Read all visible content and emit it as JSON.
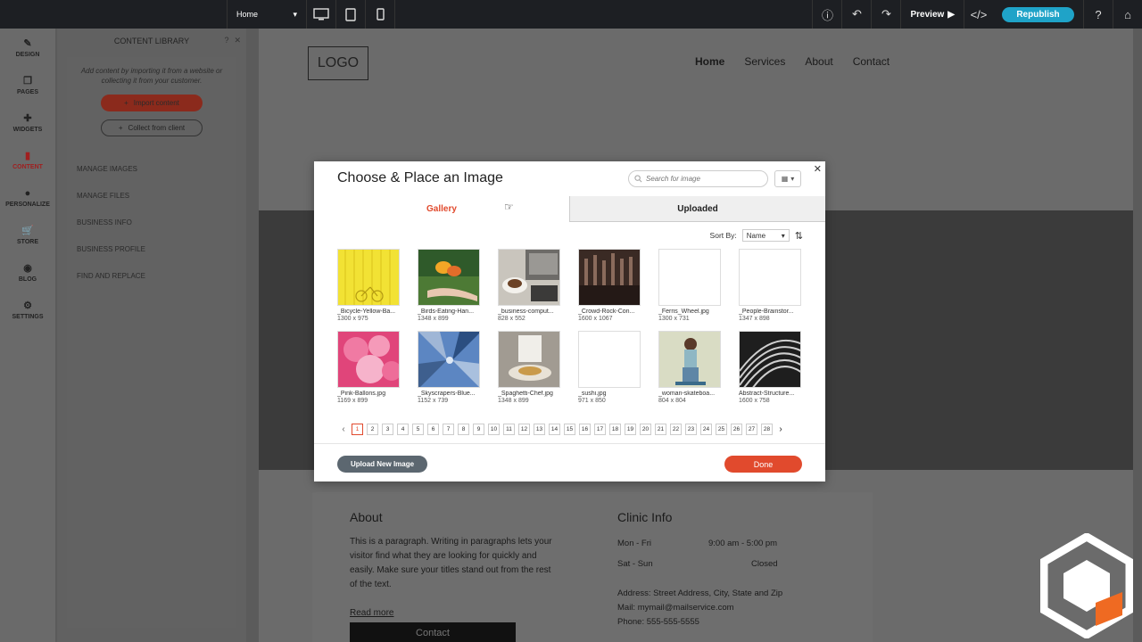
{
  "topbar": {
    "page_select": "Home",
    "preview_label": "Preview",
    "republish_label": "Republish"
  },
  "rail": {
    "items": [
      {
        "label": "DESIGN",
        "icon": "brush-icon"
      },
      {
        "label": "PAGES",
        "icon": "pages-icon"
      },
      {
        "label": "WIDGETS",
        "icon": "plus-icon"
      },
      {
        "label": "CONTENT",
        "icon": "folder-icon"
      },
      {
        "label": "PERSONALIZE",
        "icon": "person-icon"
      },
      {
        "label": "STORE",
        "icon": "cart-icon"
      },
      {
        "label": "BLOG",
        "icon": "chat-icon"
      },
      {
        "label": "SETTINGS",
        "icon": "gear-icon"
      }
    ],
    "active": "CONTENT"
  },
  "panel": {
    "title": "CONTENT LIBRARY",
    "description": "Add content by importing it from a website or collecting it from your customer.",
    "import_label": "Import content",
    "collect_label": "Collect from client",
    "links": [
      "MANAGE IMAGES",
      "MANAGE FILES",
      "BUSINESS INFO",
      "BUSINESS PROFILE",
      "FIND AND REPLACE"
    ]
  },
  "site": {
    "logo": "LOGO",
    "nav": [
      "Home",
      "Services",
      "About",
      "Contact"
    ],
    "about_title": "About",
    "about_text": "This is a paragraph. Writing in paragraphs lets your visitor find what they are looking for quickly and easily. Make sure your titles stand out from the rest of the text.",
    "read_more": "Read more",
    "contact_label": "Contact",
    "clinic_title": "Clinic Info",
    "hours": [
      {
        "day": "Mon - Fri",
        "time": "9:00 am - 5:00 pm"
      },
      {
        "day": "Sat - Sun",
        "time": "Closed"
      }
    ],
    "address": "Address: Street Address, City, State and Zip",
    "mail": "Mail: mymail@mailservice.com",
    "phone": "Phone: 555-555-5555"
  },
  "modal": {
    "title": "Choose & Place an Image",
    "search_placeholder": "Search for image",
    "tabs": [
      "Gallery",
      "Uploaded"
    ],
    "sort_label": "Sort By:",
    "sort_value": "Name",
    "images": [
      {
        "name": "_Bicycle-Yellow-Ba...",
        "dims": "1300 x 975"
      },
      {
        "name": "_Birds-Eating-Han...",
        "dims": "1348 x 899"
      },
      {
        "name": "_business-comput...",
        "dims": "828 x 552"
      },
      {
        "name": "_Crowd-Rock-Con...",
        "dims": "1600 x 1067"
      },
      {
        "name": "_Ferris_Wheel.jpg",
        "dims": "1300 x 731"
      },
      {
        "name": "_People-Brainstor...",
        "dims": "1347 x 898"
      },
      {
        "name": "_Pink-Ballons.jpg",
        "dims": "1169 x 899"
      },
      {
        "name": "_Skyscrapers-Blue...",
        "dims": "1152 x 739"
      },
      {
        "name": "_Spaghetti-Chef.jpg",
        "dims": "1348 x 899"
      },
      {
        "name": "_sushi.jpg",
        "dims": "971 x 850"
      },
      {
        "name": "_woman-skateboa...",
        "dims": "804 x 804"
      },
      {
        "name": "Abstract-Structure...",
        "dims": "1600 x 758"
      }
    ],
    "pages": [
      "1",
      "2",
      "3",
      "4",
      "5",
      "6",
      "7",
      "8",
      "9",
      "10",
      "11",
      "12",
      "13",
      "14",
      "15",
      "16",
      "17",
      "18",
      "19",
      "20",
      "21",
      "22",
      "23",
      "24",
      "25",
      "26",
      "27",
      "28"
    ],
    "current_page": "1",
    "upload_label": "Upload New Image",
    "done_label": "Done"
  },
  "colors": {
    "accent": "#e14a2d",
    "republish": "#1fa3c8",
    "topbar": "#1d1f23"
  }
}
